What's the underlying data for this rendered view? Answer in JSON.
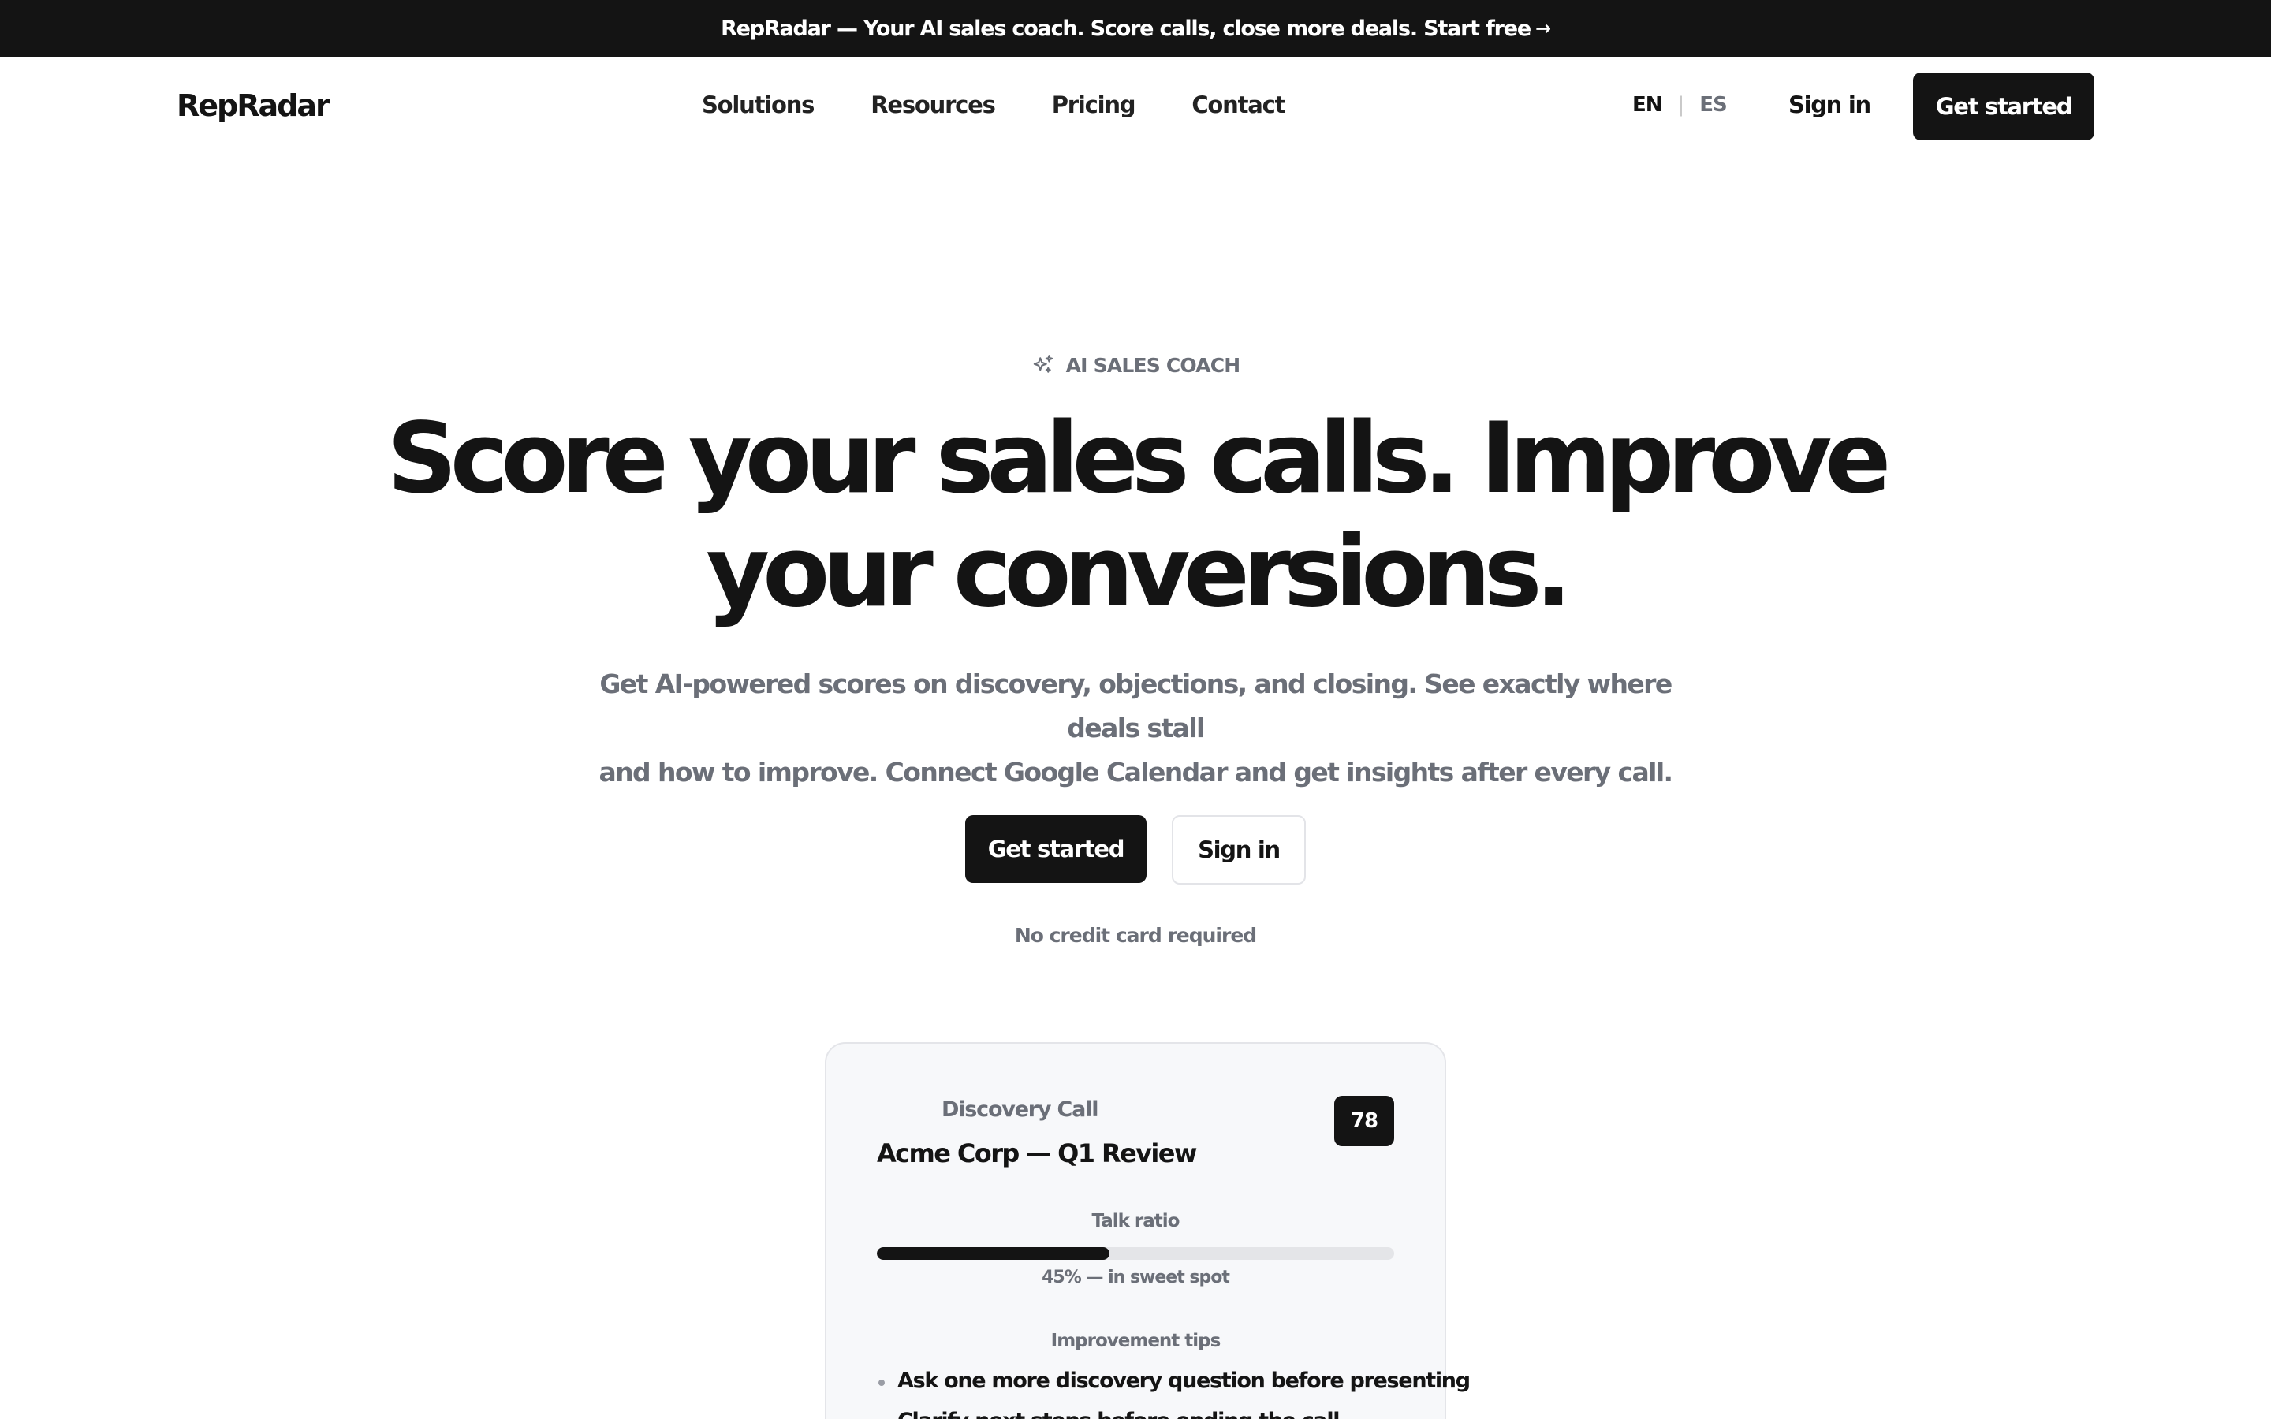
{
  "announcement": {
    "text": "RepRadar — Your AI sales coach. Score calls, close more deals. Start free",
    "arrow": "→"
  },
  "header": {
    "logo": "RepRadar",
    "nav": [
      "Solutions",
      "Resources",
      "Pricing",
      "Contact"
    ],
    "lang": {
      "en": "EN",
      "separator": "|",
      "es": "ES"
    },
    "sign_in": "Sign in",
    "cta": "Get started"
  },
  "hero": {
    "eyebrow_icon": "sparkle-icon",
    "eyebrow": "AI SALES COACH",
    "headline_line1": "Score your sales calls. Improve",
    "headline_line2": "your conversions.",
    "subhead_line1": "Get AI-powered scores on discovery, objections, and closing. See exactly where deals stall",
    "subhead_line2": "and how to improve. Connect Google Calendar and get insights after every call.",
    "primary_cta": "Get started",
    "secondary_cta": "Sign in",
    "note": "No credit card required"
  },
  "preview_card": {
    "type": "Discovery Call",
    "title": "Acme Corp — Q1 Review",
    "score": "78",
    "talk_ratio_label": "Talk ratio",
    "talk_ratio_percent": 45,
    "talk_ratio_caption": "45% — in sweet spot",
    "tips_label": "Improvement tips",
    "tips": [
      "Ask one more discovery question before presenting",
      "Clarify next steps before ending the call"
    ]
  },
  "colors": {
    "primary": "#141414",
    "muted_text": "#6b6f78",
    "card_bg": "#f7f8fa",
    "border": "#e4e5e9"
  }
}
